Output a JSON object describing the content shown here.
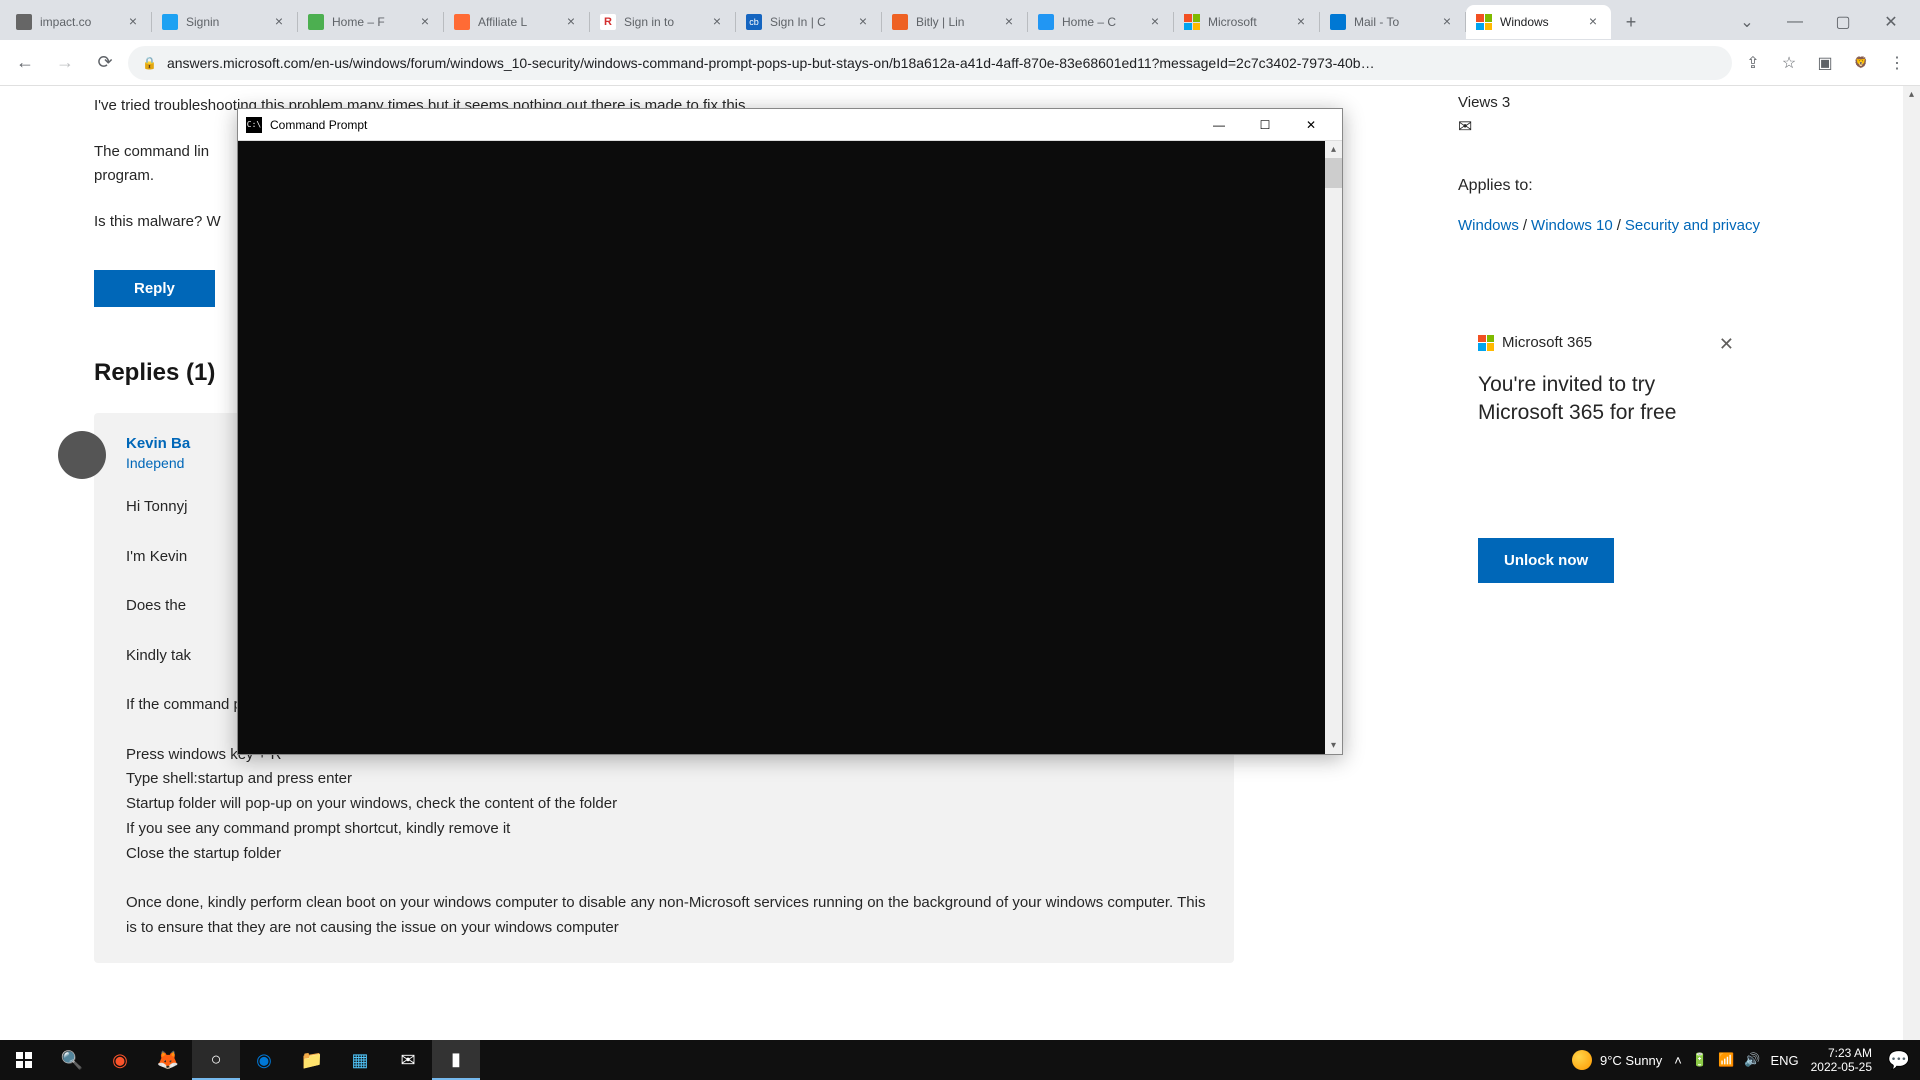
{
  "tabs": [
    {
      "title": "impact.co"
    },
    {
      "title": "Signin"
    },
    {
      "title": "Home – F"
    },
    {
      "title": "Affiliate L"
    },
    {
      "title": "Sign in to"
    },
    {
      "title": "Sign In | C"
    },
    {
      "title": "Bitly | Lin"
    },
    {
      "title": "Home – C"
    },
    {
      "title": "Microsoft"
    },
    {
      "title": "Mail - To"
    },
    {
      "title": "Windows",
      "active": true
    }
  ],
  "url": "answers.microsoft.com/en-us/windows/forum/windows_10-security/windows-command-prompt-pops-up-but-stays-on/b18a612a-a41d-4aff-870e-83e68601ed11?messageId=2c7c3402-7973-40b…",
  "question": {
    "line1": "I've tried troubleshooting this problem many times but it seems nothing out there is made to fix this.",
    "line2": "The command lin",
    "line2b": "program.",
    "line3": "Is this malware? W"
  },
  "reply_button": "Reply",
  "replies_heading": "Replies (1)",
  "reply": {
    "author": "Kevin Ba",
    "role": "Independ",
    "body": "Hi Tonnyj\n\nI'm Kevin \n\nDoes the \n\nKindly tak\n\nIf the command prompt appears every time the computer computer starts, kindly follow the steps below and check if the same issue appears\n\nPress windows key + R\nType shell:startup and press enter\nStartup folder will pop-up on your windows, check the content of the folder\nIf you see any command prompt shortcut, kindly remove it\nClose the startup folder\n\nOnce done, kindly perform clean boot on your windows computer to disable any non-Microsoft services running on the background of your windows computer. This is to ensure that they are not causing the issue on your windows computer"
  },
  "sidebar": {
    "views": "Views 3",
    "applies": "Applies to:",
    "bc1": "Windows",
    "bc2": "Windows 10",
    "bc3": "Security and privacy"
  },
  "promo": {
    "brand": "Microsoft 365",
    "text": "You're invited to try Microsoft 365 for free",
    "cta": "Unlock now"
  },
  "cmd": {
    "title": "Command Prompt"
  },
  "taskbar": {
    "weather": "9°C  Sunny",
    "lang": "ENG",
    "time": "7:23 AM",
    "date": "2022-05-25"
  }
}
